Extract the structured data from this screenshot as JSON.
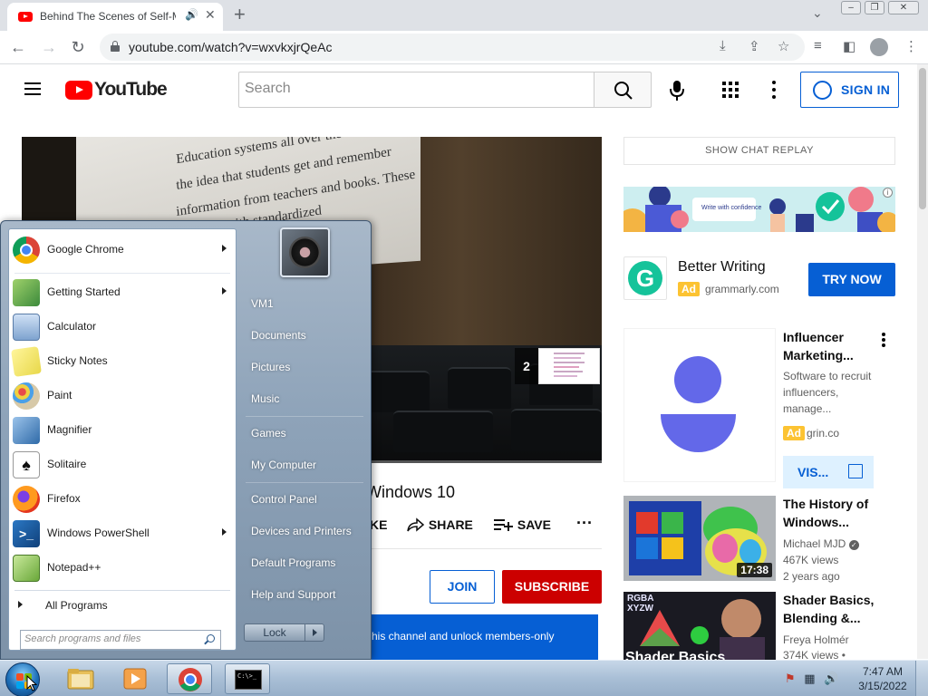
{
  "browser": {
    "tab_title": "Behind The Scenes of Self-M",
    "url": "youtube.com/watch?v=wxvkxjrQeAc",
    "new_tab_symbol": "+",
    "tab_close_symbol": "✕"
  },
  "youtube": {
    "logo_text": "YouTube",
    "search_placeholder": "Search",
    "sign_in_label": "SIGN IN",
    "video": {
      "screen_lines": [
        "Education systems all over the world",
        "the idea that students get and remember",
        "information from teachers and books. These",
        "are...ed...with standardized"
      ],
      "card_count": "2",
      "title_fragment": "Windows 10",
      "like_fragment": "KE",
      "share_label": "SHARE",
      "save_label": "SAVE",
      "join_label": "JOIN",
      "subscribe_label": "SUBSCRIBE",
      "members_banner": "his channel and unlock members-only"
    },
    "sidebar": {
      "show_chat_replay": "SHOW CHAT REPLAY",
      "ad_banner_caption": "Write with confidence",
      "grammarly_ad": {
        "title": "Better Writing",
        "badge": "Ad",
        "domain": "grammarly.com",
        "cta": "TRY NOW"
      },
      "grin_ad": {
        "title": "Influencer Marketing...",
        "description": "Software to recruit influencers, manage...",
        "badge": "Ad",
        "domain": "grin.co",
        "cta": "VIS..."
      },
      "videos": [
        {
          "title": "The History of Windows...",
          "channel": "Michael MJD",
          "views": "467K views",
          "age": "2 years ago",
          "duration": "17:38"
        },
        {
          "title": "Shader Basics, Blending &...",
          "channel": "Freya Holmér",
          "views": "374K views •",
          "age": "",
          "duration": "",
          "thumb_text": "RGBA XYZW",
          "thumb_caption": "Shader Basics"
        }
      ]
    }
  },
  "start_menu": {
    "programs": [
      {
        "label": "Google Chrome",
        "icon": "chrome-icon",
        "submenu": true
      },
      {
        "label": "Getting Started",
        "icon": "getting-started-icon",
        "submenu": true
      },
      {
        "label": "Calculator",
        "icon": "calculator-icon",
        "submenu": false
      },
      {
        "label": "Sticky Notes",
        "icon": "sticky-notes-icon",
        "submenu": false
      },
      {
        "label": "Paint",
        "icon": "paint-icon",
        "submenu": false
      },
      {
        "label": "Magnifier",
        "icon": "magnifier-icon",
        "submenu": false
      },
      {
        "label": "Solitaire",
        "icon": "solitaire-icon",
        "submenu": false
      },
      {
        "label": "Firefox",
        "icon": "firefox-icon",
        "submenu": false
      },
      {
        "label": "Windows PowerShell",
        "icon": "powershell-icon",
        "submenu": true
      },
      {
        "label": "Notepad++",
        "icon": "notepadpp-icon",
        "submenu": false
      }
    ],
    "all_programs": "All Programs",
    "search_placeholder": "Search programs and files",
    "right_links": [
      "VM1",
      "Documents",
      "Pictures",
      "Music",
      "Games",
      "My Computer",
      "Control Panel",
      "Devices and Printers",
      "Default Programs",
      "Help and Support"
    ],
    "lock_label": "Lock"
  },
  "taskbar": {
    "time": "7:47 AM",
    "date": "3/15/2022",
    "console_text": "C:\\>_"
  },
  "colors": {
    "youtube_red": "#ff0000",
    "youtube_blue": "#065fd4",
    "subscribe_red": "#cc0000",
    "ad_yellow": "#fcc332",
    "grin_purple": "#6368e9",
    "grammarly_green": "#15c39a"
  }
}
